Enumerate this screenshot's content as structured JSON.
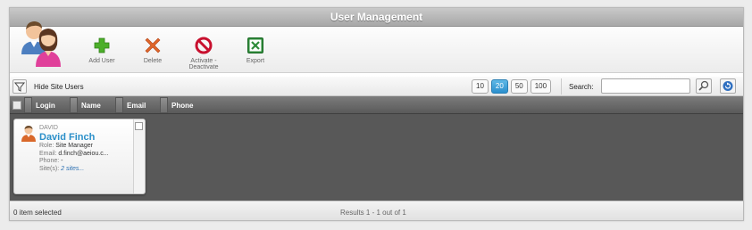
{
  "window": {
    "title": "User Management"
  },
  "toolbar": {
    "items": [
      {
        "id": "add",
        "label": "Add User",
        "icon": "plus-icon",
        "color": "#4caf2a"
      },
      {
        "id": "delete",
        "label": "Delete",
        "icon": "cross-icon",
        "color": "#e0662a"
      },
      {
        "id": "activate",
        "label_line1": "Activate -",
        "label_line2": "Deactivate",
        "icon": "ban-icon",
        "color": "#c8102e"
      },
      {
        "id": "export",
        "label": "Export",
        "icon": "excel-icon",
        "color": "#2e8b3a"
      }
    ]
  },
  "filter_bar": {
    "hide_label": "Hide Site Users",
    "page_sizes": [
      "10",
      "20",
      "50",
      "100"
    ],
    "active_page_size": "20",
    "search_label": "Search:",
    "search_value": ""
  },
  "columns": [
    "Login",
    "Name",
    "Email",
    "Phone"
  ],
  "users": [
    {
      "login": "DAVID",
      "name": "David Finch",
      "role_label": "Role:",
      "role": "Site Manager",
      "email_label": "Email:",
      "email": "d.finch@aeiou.c...",
      "phone_label": "Phone:",
      "phone": "-",
      "sites_label": "Site(s):",
      "sites": "2 sites..."
    }
  ],
  "status": {
    "selected": "0 item selected",
    "results": "Results 1 - 1 out of 1"
  },
  "colors": {
    "accent": "#2a8fc9",
    "title_bar": "#b3b3b3",
    "grid_bg": "#585858"
  }
}
